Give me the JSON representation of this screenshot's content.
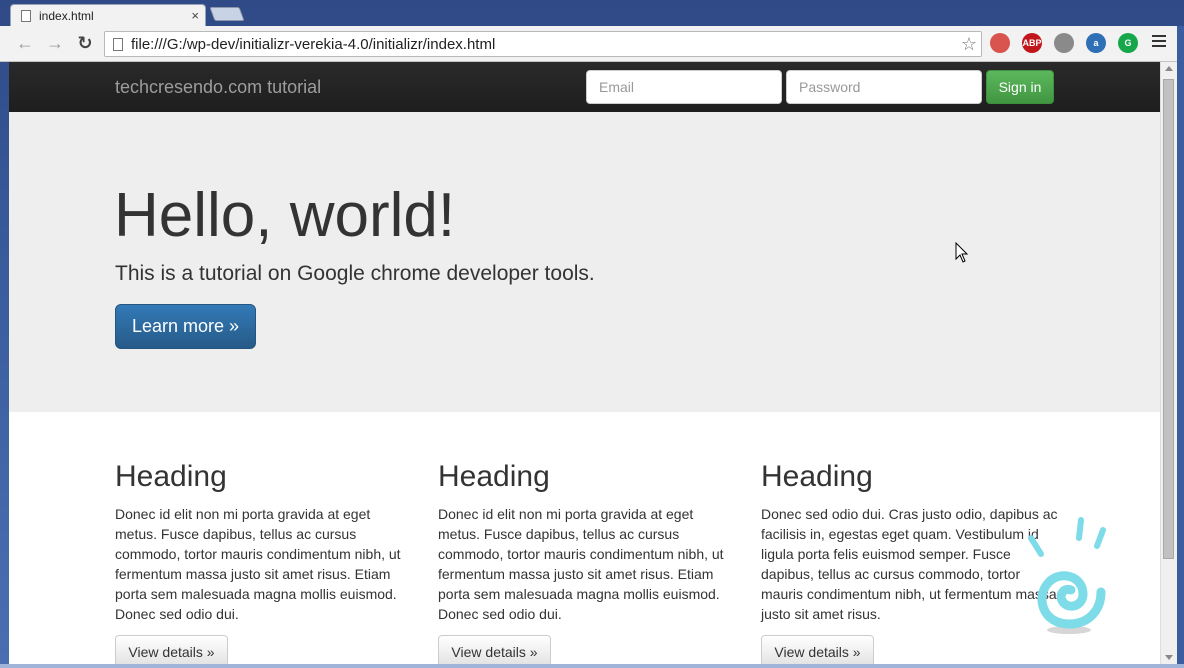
{
  "browser": {
    "tab_title": "index.html",
    "tab_close": "×",
    "url": "file:///G:/wp-dev/initializr-verekia-4.0/initializr/index.html",
    "back_glyph": "←",
    "forward_glyph": "→",
    "reload_glyph": "↻",
    "star_glyph": "☆",
    "extensions": [
      {
        "name": "pdf-ext-icon",
        "label": "",
        "color": "#d9534f"
      },
      {
        "name": "adblock-plus-icon",
        "label": "ABP",
        "color": "#c0161c"
      },
      {
        "name": "download-ext-icon",
        "label": "",
        "color": "#8a8a8a"
      },
      {
        "name": "user-ext-icon",
        "label": "a",
        "color": "#2f6fb6"
      },
      {
        "name": "grammarly-icon",
        "label": "G",
        "color": "#15a74a"
      }
    ]
  },
  "navbar": {
    "brand": "techcresendo.com tutorial",
    "email_placeholder": "Email",
    "password_placeholder": "Password",
    "signin_label": "Sign in"
  },
  "jumbotron": {
    "heading": "Hello, world!",
    "lead": "This is a tutorial on Google chrome developer tools.",
    "button_label": "Learn more »"
  },
  "columns": [
    {
      "heading": "Heading",
      "text": "Donec id elit non mi porta gravida at eget metus. Fusce dapibus, tellus ac cursus commodo, tortor mauris condimentum nibh, ut fermentum massa justo sit amet risus. Etiam porta sem malesuada magna mollis euismod. Donec sed odio dui.",
      "button_label": "View details »"
    },
    {
      "heading": "Heading",
      "text": "Donec id elit non mi porta gravida at eget metus. Fusce dapibus, tellus ac cursus commodo, tortor mauris condimentum nibh, ut fermentum massa justo sit amet risus. Etiam porta sem malesuada magna mollis euismod. Donec sed odio dui.",
      "button_label": "View details »"
    },
    {
      "heading": "Heading",
      "text": "Donec sed odio dui. Cras justo odio, dapibus ac facilisis in, egestas eget quam. Vestibulum id ligula porta felis euismod semper. Fusce dapibus, tellus ac cursus commodo, tortor mauris condimentum nibh, ut fermentum massa justo sit amet risus.",
      "button_label": "View details »"
    }
  ],
  "colors": {
    "navbar_bg": "#222222",
    "jumbotron_bg": "#eeeeee",
    "primary_button": "#337ab7",
    "success_button": "#5cb85c"
  }
}
